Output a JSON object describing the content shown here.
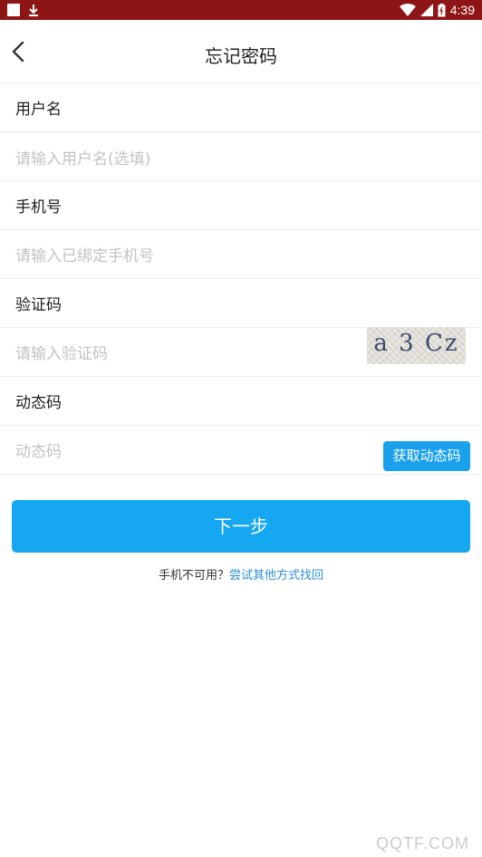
{
  "status_bar": {
    "time": "4:39",
    "background": "#8e1515"
  },
  "header": {
    "title": "忘记密码",
    "back_icon": "chevron-left-icon"
  },
  "form": {
    "username": {
      "label": "用户名",
      "placeholder": "请输入用户名(选填)"
    },
    "phone": {
      "label": "手机号",
      "placeholder": "请输入已绑定手机号"
    },
    "captcha": {
      "label": "验证码",
      "placeholder": "请输入验证码",
      "image_text": "a 3 Cz"
    },
    "otp": {
      "label": "动态码",
      "placeholder": "动态码",
      "button": "获取动态码"
    }
  },
  "actions": {
    "next": "下一步",
    "alt_question": "手机不可用？",
    "alt_link": "尝试其他方式找回"
  },
  "watermark": "QQTF.COM",
  "colors": {
    "accent": "#16a7f2",
    "link": "#2c8fd8"
  }
}
